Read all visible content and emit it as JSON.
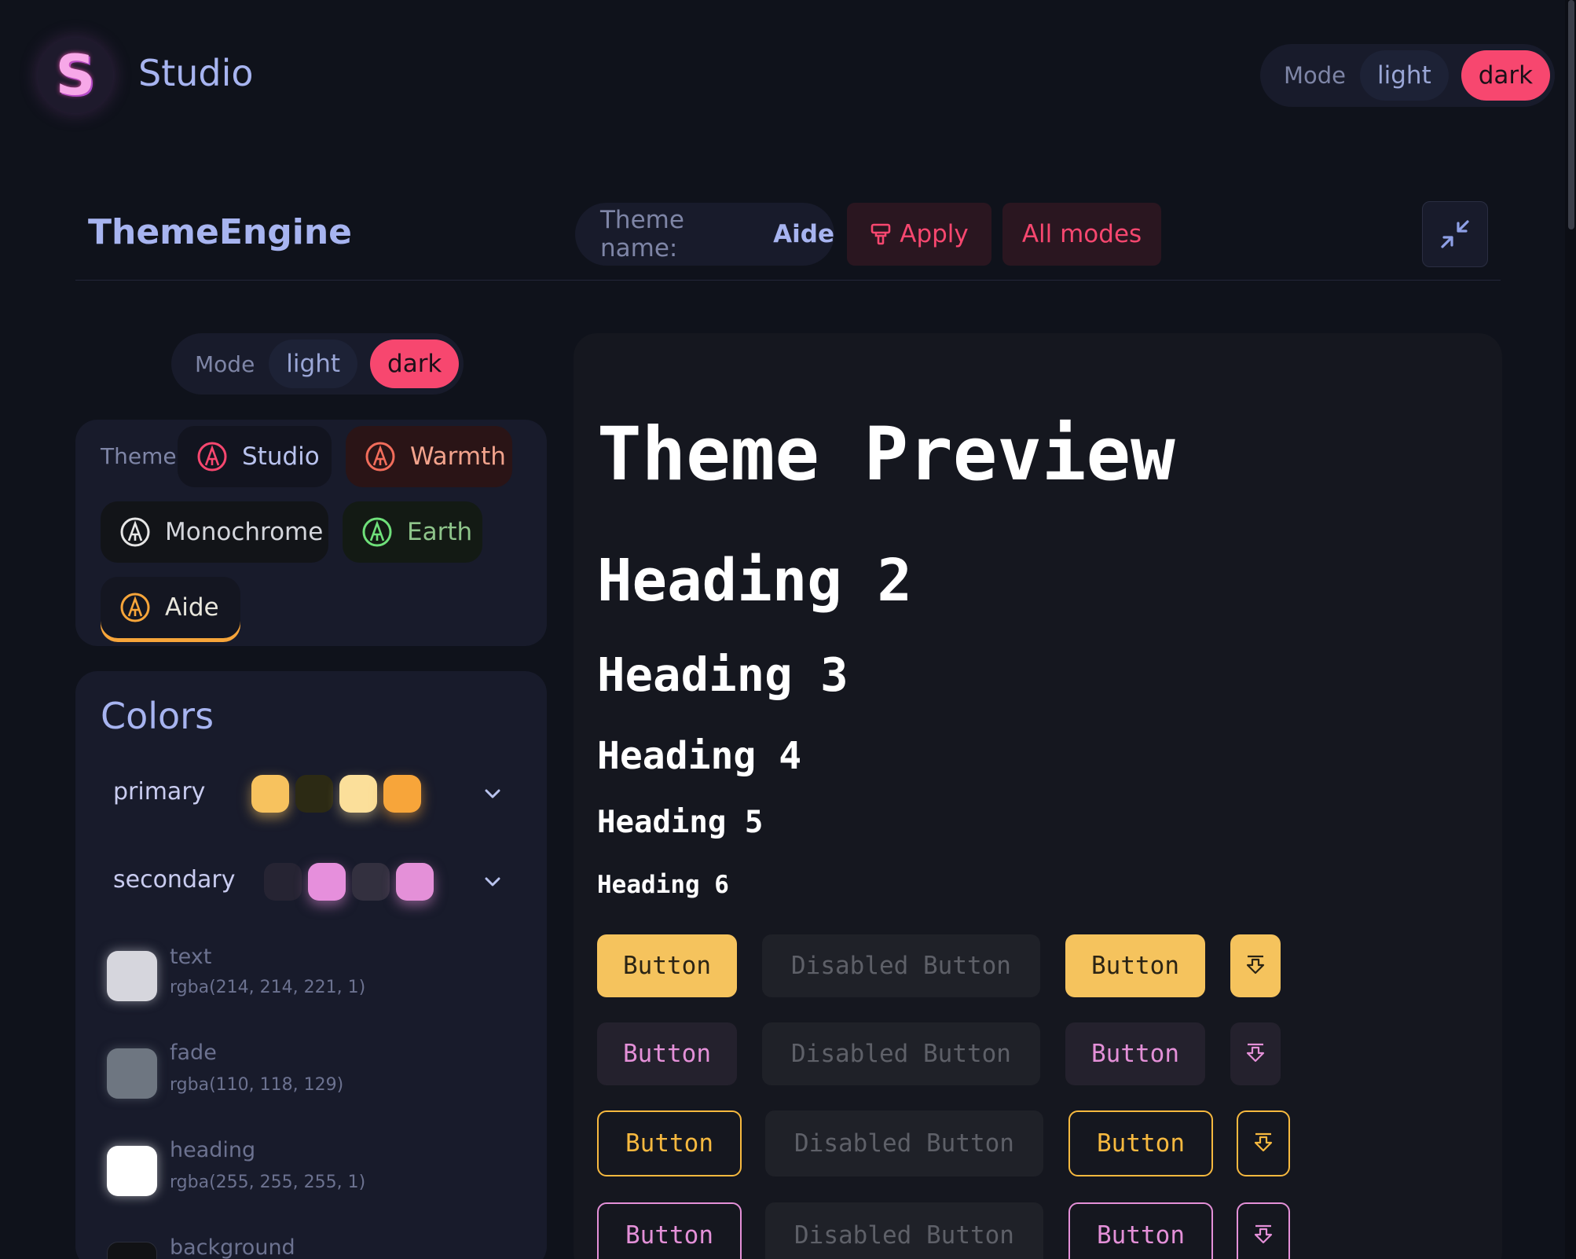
{
  "app": {
    "logo_letter": "S",
    "name": "Studio"
  },
  "top_mode": {
    "label": "Mode",
    "light": "light",
    "dark": "dark",
    "selected": "dark"
  },
  "toolbar": {
    "title": "ThemeEngine",
    "theme_name_label": "Theme name:",
    "theme_name_value": "Aide",
    "apply_label": "Apply",
    "all_modes_label": "All modes"
  },
  "side_mode": {
    "label": "Mode",
    "light": "light",
    "dark": "dark",
    "selected": "dark"
  },
  "themes": {
    "label": "Theme",
    "items": [
      "Studio",
      "Warmth",
      "Monochrome",
      "Earth",
      "Aide"
    ],
    "selected": "Aide",
    "icon_colors": [
      "#f7476f",
      "#f26d5b",
      "#e6e6e6",
      "#6fe07a",
      "#f7a53a"
    ]
  },
  "colors": {
    "title": "Colors",
    "palettes": [
      {
        "name": "primary",
        "swatches": [
          "#f7c25e",
          "#2c2a14",
          "#fbdf9a",
          "#f7a53a"
        ]
      },
      {
        "name": "secondary",
        "swatches": [
          "#262433",
          "#e68fdc",
          "#33303f",
          "#e490d8"
        ]
      }
    ],
    "tokens": [
      {
        "name": "text",
        "value": "rgba(214, 214, 221, 1)",
        "color": "#d6d6dd"
      },
      {
        "name": "fade",
        "value": "rgba(110, 118, 129)",
        "color": "#6e7681"
      },
      {
        "name": "heading",
        "value": "rgba(255, 255, 255, 1)",
        "color": "#ffffff"
      },
      {
        "name": "background",
        "value": "",
        "color": "#111215"
      }
    ]
  },
  "preview": {
    "h1": "Theme Preview",
    "h2": "Heading 2",
    "h3": "Heading 3",
    "h4": "Heading 4",
    "h5": "Heading 5",
    "h6": "Heading 6",
    "button_label": "Button",
    "disabled_label": "Disabled Button"
  }
}
